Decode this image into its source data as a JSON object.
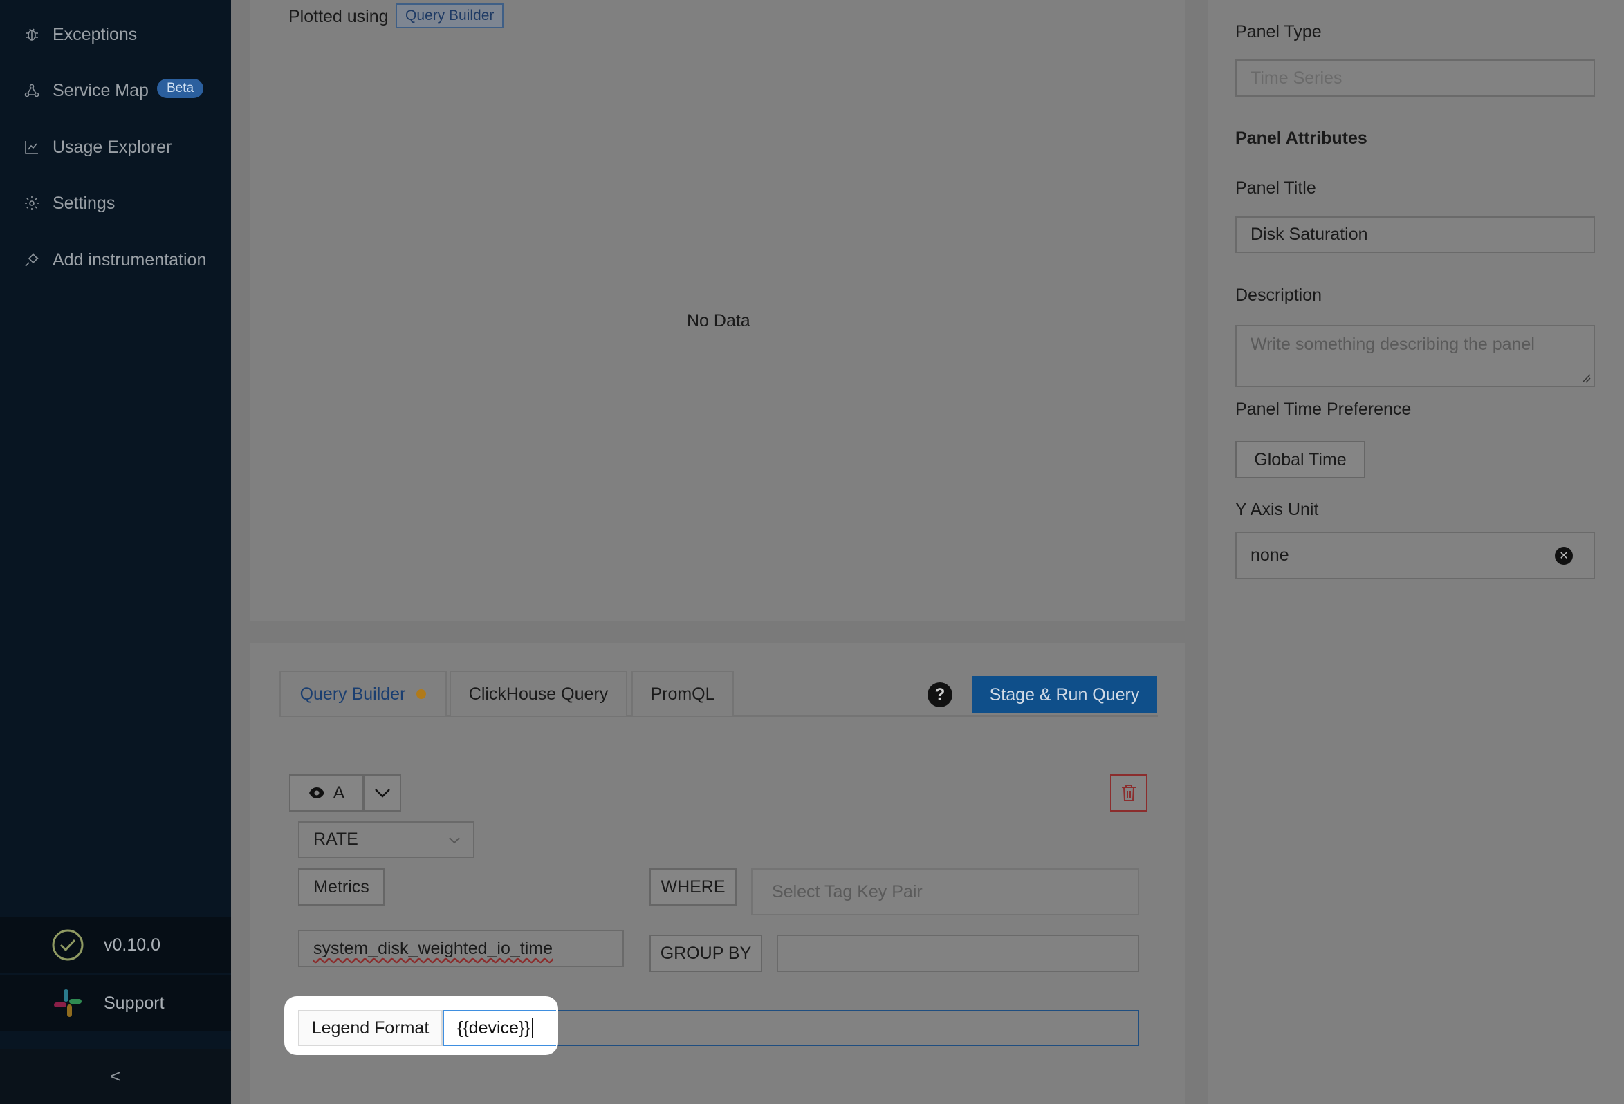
{
  "sidebar": {
    "items": [
      {
        "label": "Exceptions"
      },
      {
        "label": "Service Map",
        "badge": "Beta"
      },
      {
        "label": "Usage Explorer"
      },
      {
        "label": "Settings"
      },
      {
        "label": "Add instrumentation"
      }
    ],
    "version": "v0.10.0",
    "support": "Support",
    "collapse_glyph": "<"
  },
  "chart": {
    "plotted_using": "Plotted using",
    "plotted_tag": "Query Builder",
    "empty_text": "No Data"
  },
  "query": {
    "tabs": [
      {
        "label": "Query Builder",
        "active": true
      },
      {
        "label": "ClickHouse Query"
      },
      {
        "label": "PromQL"
      }
    ],
    "help_glyph": "?",
    "run_label": "Stage & Run Query",
    "query_name": "A",
    "aggregate": "RATE",
    "metrics_label": "Metrics",
    "metric_value": "system_disk_weighted_io_time",
    "where_label": "WHERE",
    "tag_placeholder": "Select Tag Key Pair",
    "group_by_label": "GROUP BY",
    "group_by_value": "",
    "legend_label": "Legend Format",
    "legend_value": "{{device}}"
  },
  "settings": {
    "panel_type_label": "Panel Type",
    "panel_type_value": "Time Series",
    "attributes_heading": "Panel Attributes",
    "title_label": "Panel Title",
    "title_value": "Disk Saturation",
    "description_label": "Description",
    "description_placeholder": "Write something describing the  panel",
    "time_pref_label": "Panel Time Preference",
    "time_pref_value": "Global Time",
    "y_axis_label": "Y Axis Unit",
    "y_axis_value": "none"
  },
  "colors": {
    "accent": "#1677ff",
    "sidebar_bg": "#081522",
    "highlight": "#ffffff"
  }
}
